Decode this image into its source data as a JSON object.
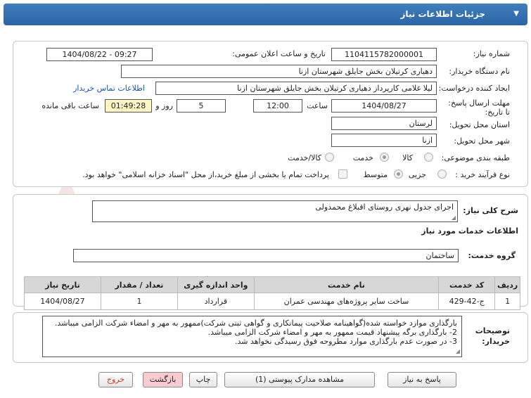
{
  "header": {
    "title": "جزئیات اطلاعات نیاز"
  },
  "fields": {
    "need_number_label": "شماره نیاز:",
    "need_number": "1104115782000001",
    "announce_label": "تاریخ و ساعت اعلان عمومی:",
    "announce_value": "1404/08/22 - 09:27",
    "buyer_org_label": "نام دستگاه خریدار:",
    "buyer_org": "دهیاری کرتیلان بخش جایلق شهرستان ازنا",
    "creator_label": "ایجاد کننده درخواست:",
    "creator": "لیلا غلامی کارپرداز دهیاری کرتیلان بخش جایلق شهرستان ازنا",
    "contact_link": "اطلاعات تماس خریدار",
    "deadline_label": "مهلت ارسال پاسخ: تا تاریخ:",
    "deadline_date": "1404/08/27",
    "time_label": "ساعت",
    "deadline_time": "12:00",
    "days_value": "5",
    "days_label": "روز و",
    "remaining_time": "01:49:28",
    "remaining_label": "ساعت باقی مانده",
    "province_label": "استان محل تحویل:",
    "province": "لرستان",
    "city_label": "شهر محل تحویل:",
    "city": "ازنا",
    "category_label": "طبقه بندی موضوعی:",
    "category_options": [
      "کالا",
      "خدمت",
      "کالا/خدمت"
    ],
    "category_selected": "خدمت",
    "process_label": "نوع فرآیند خرید :",
    "process_options": [
      "جزیی",
      "متوسط"
    ],
    "process_selected": "متوسط",
    "payment_note": "پرداخت تمام یا بخشی از مبلغ خرید،از محل \"اسناد خزانه اسلامی\" خواهد بود."
  },
  "summary": {
    "label": "شرح کلی نیاز:",
    "value": "اجرای جدول نهری روستای اقبلاغ محمدولی"
  },
  "services": {
    "section_title": "اطلاعات خدمات مورد نیاز",
    "group_label": "گروه خدمت:",
    "group_value": "ساختمان",
    "columns": [
      "ردیف",
      "کد خدمت",
      "نام خدمت",
      "واحد اندازه گیری",
      "تعداد / مقدار",
      "تاریخ نیاز"
    ],
    "rows": [
      [
        "1",
        "ج-42-429",
        "ساخت سایر پروژه‌های مهندسی عمران",
        "قرارداد",
        "1",
        "1404/08/27"
      ]
    ]
  },
  "buyer_notes": {
    "label": "توضیحات خریدار:",
    "lines": [
      "بارگذاری موارد خواسته شده(گواهینامه صلاحیت پیمانکاری و گواهی ثبتی شرکت)ممهور به مهر و امضاء شرکت الزامی میباشد.",
      "2- بارگذاری برگه پیشنهاد قیمت ممهور به مهر و امضاء شرکت الزامی میباشد.",
      "3- در صورت عدم بارگذاری موارد مطروحه فوق رسیدگی نخواهد شد."
    ]
  },
  "buttons": {
    "reply": "پاسخ به نیاز",
    "attachments": "مشاهده مدارک پیوستی (1)",
    "print": "چاپ",
    "back": "بازگشت",
    "exit": "خروج"
  },
  "watermark": {
    "text": "AriaTender.neT"
  },
  "colors": {
    "header": "#2c64a4",
    "link": "#1a57a6",
    "exit_text": "#c0392b",
    "back_bg": "#f7cbd0",
    "remaining_bg": "#fdf6c3"
  }
}
